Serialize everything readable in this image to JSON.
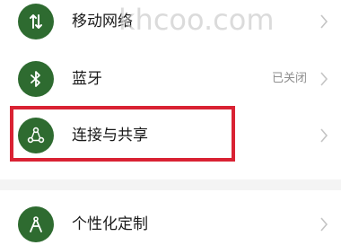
{
  "settings": {
    "items": [
      {
        "label": "移动网络",
        "status": "",
        "icon": "mobile-data-icon"
      },
      {
        "label": "蓝牙",
        "status": "已关闭",
        "icon": "bluetooth-icon"
      },
      {
        "label": "连接与共享",
        "status": "",
        "icon": "share-icon"
      },
      {
        "label": "个性化定制",
        "status": "",
        "icon": "personalize-icon"
      }
    ]
  },
  "watermark": "khcoo.com",
  "colors": {
    "icon_bg": "#2e6b30",
    "highlight": "#d92233",
    "chevron": "#c4c4c4",
    "status_text": "#8e8e8e"
  }
}
